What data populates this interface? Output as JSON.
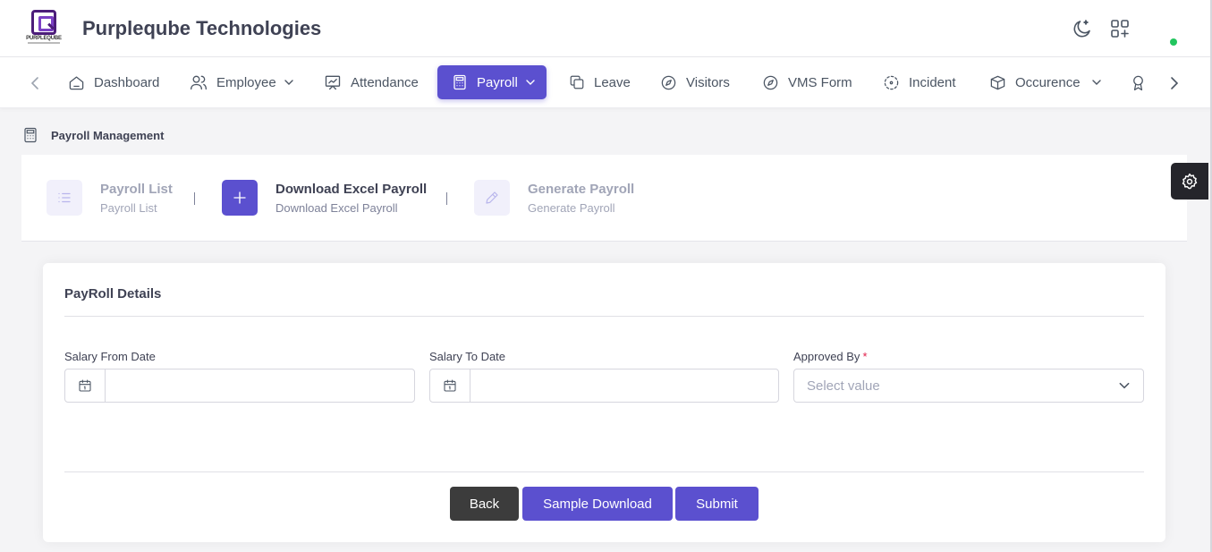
{
  "header": {
    "logo_text": "PURPLEQUBE",
    "company": "Purpleqube Technologies",
    "icons": [
      "moon-icon",
      "apps-add-icon"
    ],
    "status_color": "#22c55e"
  },
  "nav": {
    "items": [
      {
        "label": "Dashboard",
        "icon": "home-icon"
      },
      {
        "label": "Employee",
        "icon": "users-icon",
        "dropdown": true
      },
      {
        "label": "Attendance",
        "icon": "presentation-icon"
      },
      {
        "label": "Payroll",
        "icon": "calculator-icon",
        "dropdown": true,
        "active": true
      },
      {
        "label": "Leave",
        "icon": "copy-icon"
      },
      {
        "label": "Visitors",
        "icon": "compass-icon"
      },
      {
        "label": "VMS Form",
        "icon": "compass-icon"
      },
      {
        "label": "Incident",
        "icon": "focus-icon"
      },
      {
        "label": "Occurence",
        "icon": "box-icon",
        "dropdown": true
      }
    ],
    "accent": "#5b50cf"
  },
  "breadcrumb": {
    "label": "Payroll Management"
  },
  "steps": [
    {
      "title": "Payroll List",
      "subtitle": "Payroll List",
      "icon": "list-icon",
      "active": false
    },
    {
      "title": "Download Excel Payroll",
      "subtitle": "Download Excel Payroll",
      "icon": "plus-icon",
      "active": true
    },
    {
      "title": "Generate Payroll",
      "subtitle": "Generate Payroll",
      "icon": "pencil-icon",
      "active": false
    }
  ],
  "step_separator": "|",
  "form": {
    "title": "PayRoll Details",
    "salary_from": {
      "label": "Salary From Date",
      "value": ""
    },
    "salary_to": {
      "label": "Salary To Date",
      "value": ""
    },
    "approved_by": {
      "label": "Approved By",
      "required_mark": "*",
      "placeholder": "Select value"
    },
    "buttons": {
      "back": "Back",
      "sample_download": "Sample Download",
      "submit": "Submit"
    }
  }
}
